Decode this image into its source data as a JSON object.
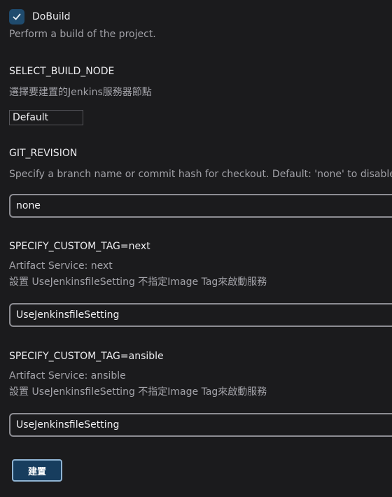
{
  "dobuild": {
    "label": "DoBuild",
    "checked": true,
    "description": "Perform a build of the project."
  },
  "params": [
    {
      "name": "SELECT_BUILD_NODE",
      "description": [
        "選擇要建置的Jenkins服務器節點"
      ],
      "type": "select",
      "value": "Default"
    },
    {
      "name": "GIT_REVISION",
      "description": [
        "Specify a branch name or commit hash for checkout. Default: 'none' to disable."
      ],
      "type": "text",
      "value": "none"
    },
    {
      "name": "SPECIFY_CUSTOM_TAG=next",
      "description": [
        "Artifact Service: next",
        "設置 UseJenkinsfileSetting 不指定Image Tag來啟動服務"
      ],
      "type": "text",
      "value": "UseJenkinsfileSetting"
    },
    {
      "name": "SPECIFY_CUSTOM_TAG=ansible",
      "description": [
        "Artifact Service: ansible",
        "設置 UseJenkinsfileSetting 不指定Image Tag來啟動服務"
      ],
      "type": "text",
      "value": "UseJenkinsfileSetting"
    }
  ],
  "build_button": {
    "label": "建置"
  },
  "colors": {
    "background": "#1b1b1d",
    "checkbox": "#1f4b6e",
    "button": "#173d5e",
    "button_border": "#8fb3d2"
  }
}
